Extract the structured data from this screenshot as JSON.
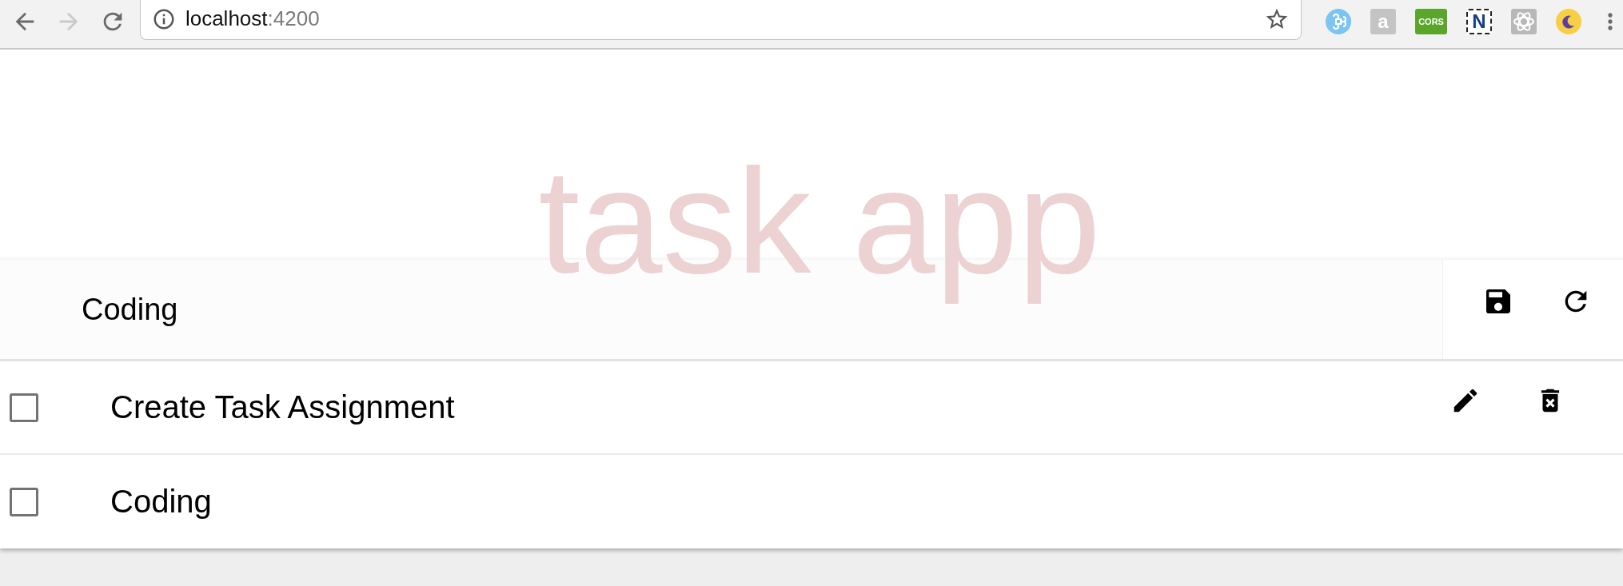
{
  "browser": {
    "nav": [
      {
        "kind": "back",
        "disabled": false
      },
      {
        "kind": "forward",
        "disabled": true
      },
      {
        "kind": "reload",
        "disabled": false
      }
    ],
    "url": {
      "host": "localhost",
      "port": ":4200"
    },
    "extensions": [
      {
        "kind": "command"
      },
      {
        "kind": "letter",
        "label": "a"
      },
      {
        "kind": "badge",
        "label": "CORS"
      },
      {
        "kind": "capture",
        "label": "N"
      },
      {
        "kind": "atom"
      },
      {
        "kind": "moon"
      }
    ]
  },
  "title": "task app",
  "header": {
    "value": "Coding",
    "buttons": [
      {
        "kind": "save"
      },
      {
        "kind": "refresh"
      }
    ]
  },
  "tasks": [
    {
      "title": "Create Task Assignment",
      "checked": false,
      "hovered": true
    },
    {
      "title": "Coding",
      "checked": false,
      "hovered": false
    }
  ]
}
